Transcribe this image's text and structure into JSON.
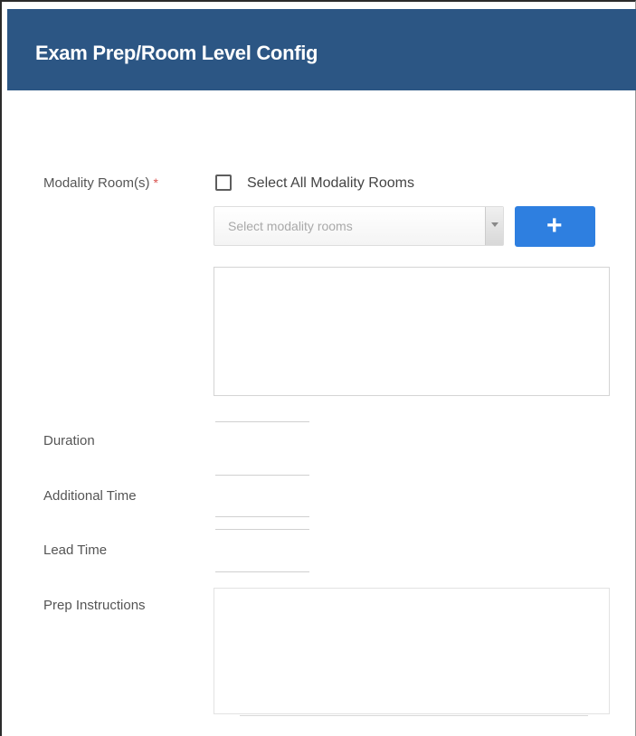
{
  "header": {
    "title": "Exam Prep/Room Level Config"
  },
  "form": {
    "modality_rooms": {
      "label": "Modality Room(s)",
      "required_mark": "*",
      "select_all_label": "Select All Modality Rooms",
      "select_all_checked": false,
      "select_placeholder": "Select modality rooms",
      "add_button_icon": "+"
    },
    "duration": {
      "label": "Duration",
      "value": ""
    },
    "additional_time": {
      "label": "Additional Time",
      "value": ""
    },
    "lead_time": {
      "label": "Lead Time",
      "value": ""
    },
    "prep_instructions": {
      "label": "Prep Instructions",
      "value": ""
    }
  },
  "colors": {
    "header_bg": "#2c5684",
    "primary_button": "#2e7fe0",
    "required": "#d9534f"
  }
}
